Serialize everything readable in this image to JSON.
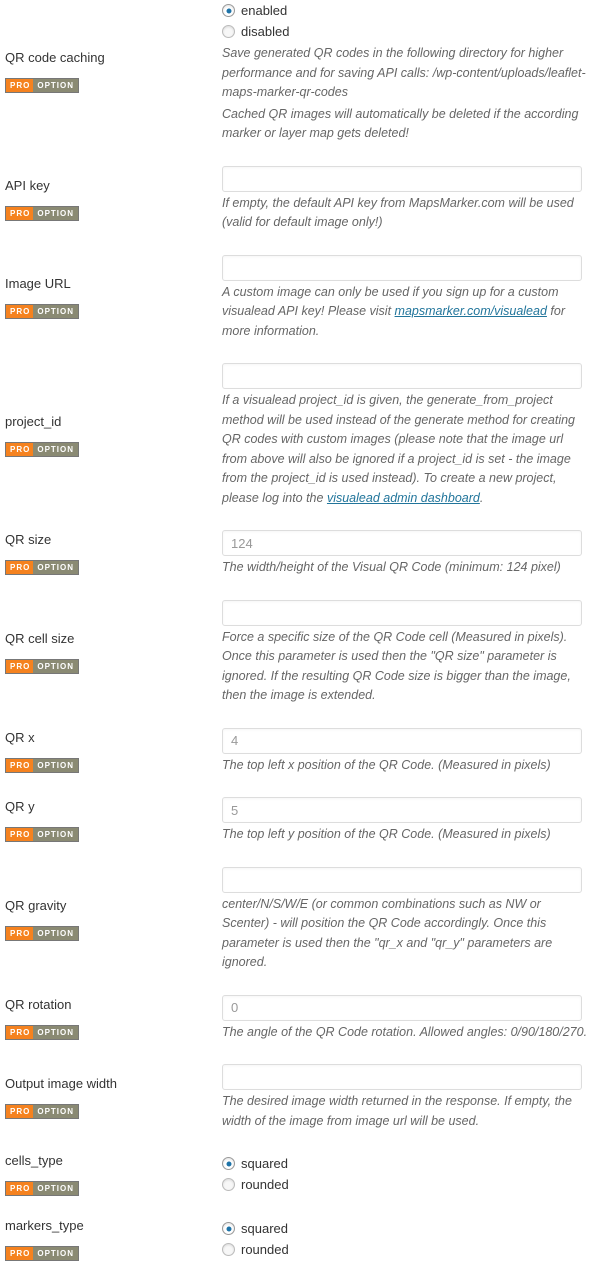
{
  "rows": [
    {
      "id": "qr-code-caching",
      "label": "QR code caching",
      "badge": {
        "pro": "PRO",
        "option": "OPTION"
      },
      "field_type": "radio",
      "radios": [
        {
          "label": "enabled",
          "checked": true
        },
        {
          "label": "disabled",
          "checked": false
        }
      ],
      "descriptions": [
        "Save generated QR codes in the following directory for higher performance and for saving API calls: /wp-content/uploads/leaflet-maps-marker-qr-codes",
        "Cached QR images will automatically be deleted if the according marker or layer map gets deleted!"
      ]
    },
    {
      "id": "api-key",
      "label": "API key",
      "badge": {
        "pro": "PRO",
        "option": "OPTION"
      },
      "field_type": "text",
      "value": "",
      "placeholder": "",
      "descriptions": [
        "If empty, the default API key from MapsMarker.com will be used (valid for default image only!)"
      ]
    },
    {
      "id": "image-url",
      "label": "Image URL",
      "badge": {
        "pro": "PRO",
        "option": "OPTION"
      },
      "field_type": "text",
      "value": "",
      "placeholder": "",
      "descriptions": [
        "A custom image can only be used if you sign up for a custom visualead API key! Please visit ",
        "mapsmarker.com/visualead",
        " for more information."
      ],
      "link_text": "mapsmarker.com/visualead"
    },
    {
      "id": "project-id",
      "label": "project_id",
      "badge": {
        "pro": "PRO",
        "option": "OPTION"
      },
      "field_type": "text",
      "value": "",
      "placeholder": "",
      "descriptions": [
        "If a visualead project_id is given, the generate_from_project method will be used instead of the generate method for creating QR codes with custom images (please note that the image url from above will also be ignored if a project_id is set - the image from the project_id is used instead). To create a new project, please log into the ",
        "visualead admin dashboard",
        "."
      ],
      "link_text": "visualead admin dashboard"
    },
    {
      "id": "qr-size",
      "label": "QR size",
      "badge": {
        "pro": "PRO",
        "option": "OPTION"
      },
      "field_type": "text",
      "value": "",
      "placeholder": "124",
      "descriptions": [
        "The width/height of the Visual QR Code (minimum: 124 pixel)"
      ]
    },
    {
      "id": "qr-cell-size",
      "label": "QR cell size",
      "badge": {
        "pro": "PRO",
        "option": "OPTION"
      },
      "field_type": "text",
      "value": "",
      "placeholder": "",
      "descriptions": [
        "Force a specific size of the QR Code cell (Measured in pixels). Once this parameter is used then the \"QR size\" parameter is ignored. If the resulting QR Code size is bigger than the image, then the image is extended."
      ]
    },
    {
      "id": "qr-x",
      "label": "QR x",
      "badge": {
        "pro": "PRO",
        "option": "OPTION"
      },
      "field_type": "text",
      "value": "",
      "placeholder": "4",
      "descriptions": [
        "The top left x position of the QR Code. (Measured in pixels)"
      ]
    },
    {
      "id": "qr-y",
      "label": "QR y",
      "badge": {
        "pro": "PRO",
        "option": "OPTION"
      },
      "field_type": "text",
      "value": "",
      "placeholder": "5",
      "descriptions": [
        "The top left y position of the QR Code. (Measured in pixels)"
      ]
    },
    {
      "id": "qr-gravity",
      "label": "QR gravity",
      "badge": {
        "pro": "PRO",
        "option": "OPTION"
      },
      "field_type": "text",
      "value": "",
      "placeholder": "",
      "descriptions": [
        "center/N/S/W/E (or common combinations such as NW or Scenter) - will position the QR Code accordingly. Once this parameter is used then the \"qr_x and \"qr_y\" parameters are ignored."
      ]
    },
    {
      "id": "qr-rotation",
      "label": "QR rotation",
      "badge": {
        "pro": "PRO",
        "option": "OPTION"
      },
      "field_type": "text",
      "value": "",
      "placeholder": "0",
      "descriptions": [
        "The angle of the QR Code rotation. Allowed angles: 0/90/180/270."
      ]
    },
    {
      "id": "output-image-width",
      "label": "Output image width",
      "badge": {
        "pro": "PRO",
        "option": "OPTION"
      },
      "field_type": "text",
      "value": "",
      "placeholder": "",
      "descriptions": [
        "The desired image width returned in the response. If empty, the width of the image from image url will be used."
      ]
    },
    {
      "id": "cells-type",
      "label": "cells_type",
      "badge": {
        "pro": "PRO",
        "option": "OPTION"
      },
      "field_type": "radio",
      "radios": [
        {
          "label": "squared",
          "checked": true
        },
        {
          "label": "rounded",
          "checked": false
        }
      ],
      "descriptions": []
    },
    {
      "id": "markers-type",
      "label": "markers_type",
      "badge": {
        "pro": "PRO",
        "option": "OPTION"
      },
      "field_type": "radio",
      "radios": [
        {
          "label": "squared",
          "checked": true
        },
        {
          "label": "rounded",
          "checked": false
        }
      ],
      "descriptions": []
    }
  ],
  "colors": {
    "pro_badge_orange": "#f5821f",
    "option_badge_gray": "#8a8a73",
    "link_blue": "#21759b",
    "radio_dot_blue": "#1e73a8",
    "description_text": "#666666",
    "label_text": "#333333",
    "input_border": "#dddddd",
    "placeholder_text": "#999999"
  }
}
